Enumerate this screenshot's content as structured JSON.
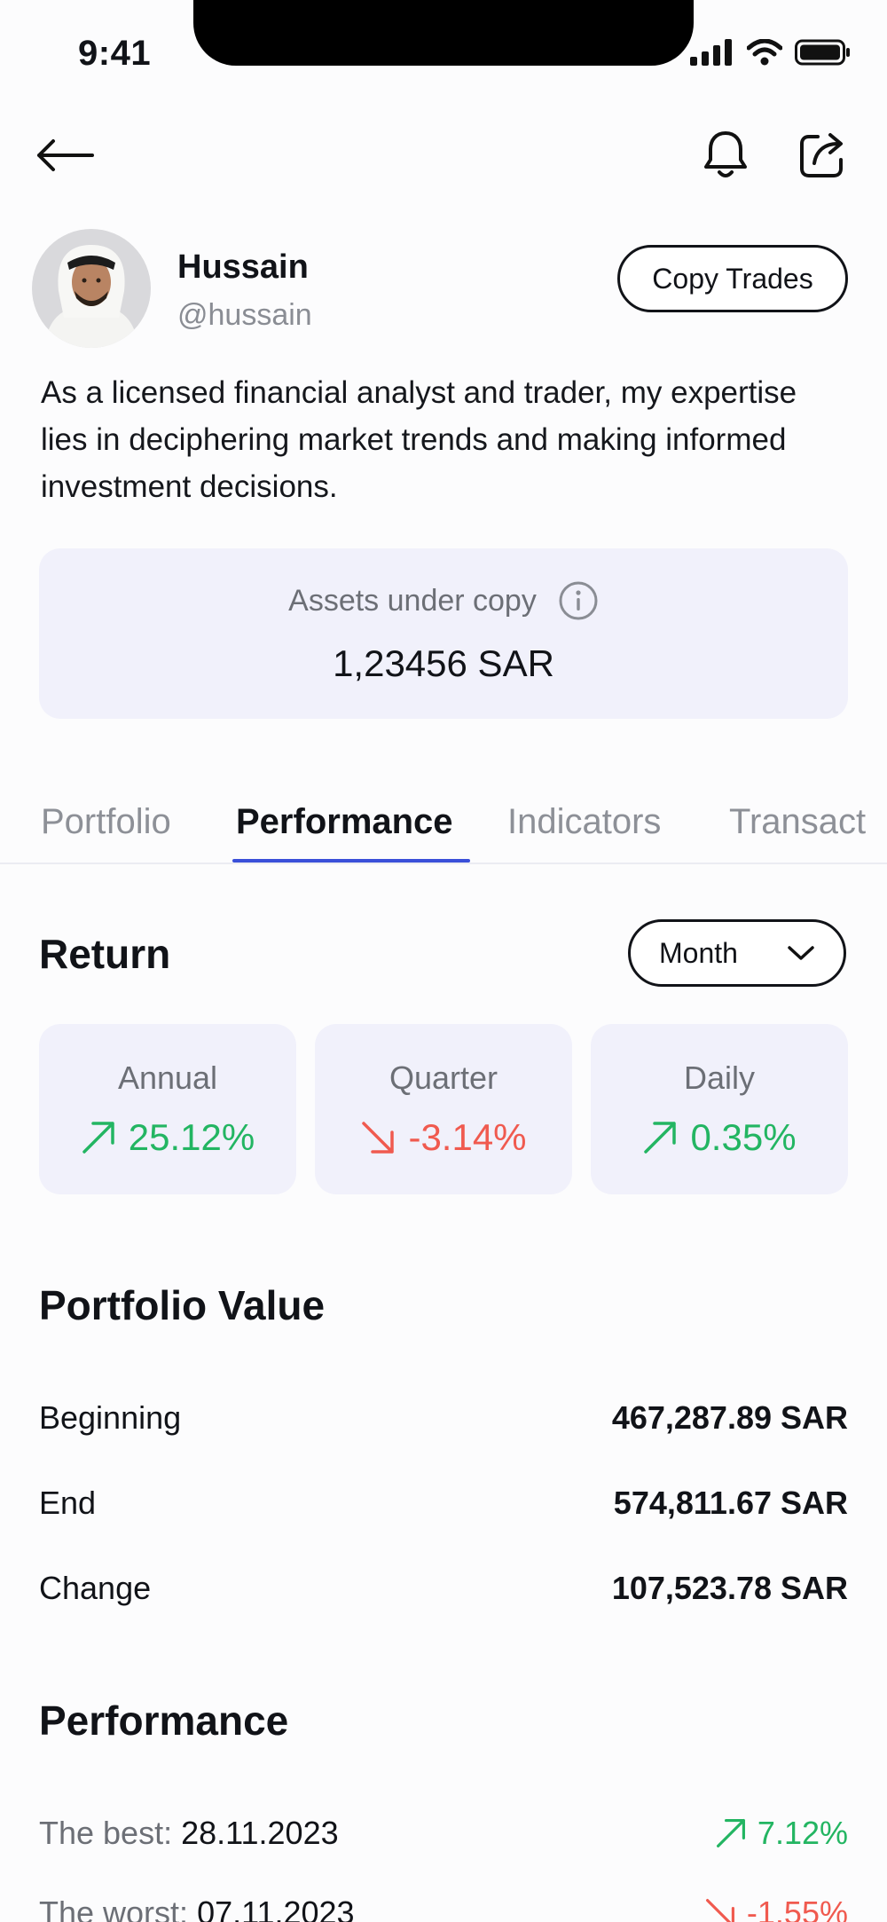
{
  "status_bar": {
    "time": "9:41"
  },
  "profile": {
    "name": "Hussain",
    "handle": "@hussain",
    "copy_button": "Copy Trades",
    "bio": "As a licensed financial analyst and trader, my expertise lies in deciphering market trends and making informed investment decisions."
  },
  "assets": {
    "label": "Assets under copy",
    "value": "1,23456 SAR"
  },
  "tabs": [
    {
      "label": "Portfolio",
      "active": false
    },
    {
      "label": "Performance",
      "active": true
    },
    {
      "label": "Indicators",
      "active": false
    },
    {
      "label": "Transact",
      "active": false
    }
  ],
  "return_section": {
    "title": "Return",
    "period_select": "Month",
    "cards": [
      {
        "label": "Annual",
        "value": "25.12%",
        "direction": "up"
      },
      {
        "label": "Quarter",
        "value": "-3.14%",
        "direction": "down"
      },
      {
        "label": "Daily",
        "value": "0.35%",
        "direction": "up"
      }
    ]
  },
  "portfolio_value": {
    "title": "Portfolio Value",
    "rows": [
      {
        "label": "Beginning",
        "value": "467,287.89 SAR"
      },
      {
        "label": "End",
        "value": "574,811.67 SAR"
      },
      {
        "label": "Change",
        "value": "107,523.78 SAR"
      }
    ]
  },
  "performance": {
    "title": "Performance",
    "rows": [
      {
        "key": "The best:",
        "date": "28.11.2023",
        "value": "7.12%",
        "direction": "up"
      },
      {
        "key": "The worst:",
        "date": "07.11.2023",
        "value": "-1.55%",
        "direction": "down"
      }
    ]
  },
  "colors": {
    "accent": "#3a4fd9",
    "positive": "#23b562",
    "negative": "#f05a4f",
    "card_bg": "#f1f1fb"
  },
  "icons": [
    "back-arrow-icon",
    "bell-icon",
    "share-icon",
    "info-icon",
    "chevron-down-icon",
    "arrow-up-right-icon",
    "arrow-down-right-icon",
    "signal-icon",
    "wifi-icon",
    "battery-icon"
  ]
}
